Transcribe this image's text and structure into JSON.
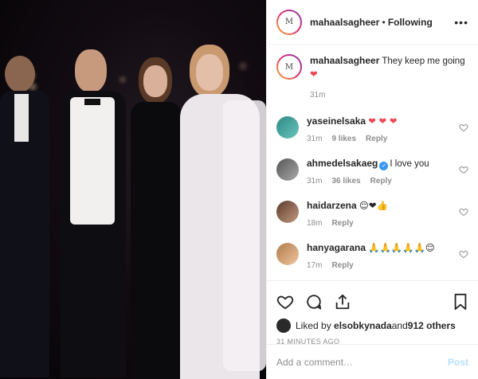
{
  "header": {
    "username": "mahaalsagheer",
    "separator": " • ",
    "follow_status": "Following",
    "more": "•••"
  },
  "caption": {
    "username": "mahaalsagheer",
    "text": "They keep me going",
    "emoji": "❤",
    "time": "31m"
  },
  "comments": [
    {
      "username": "yaseinelsaka",
      "text": "",
      "emoji": "❤ ❤ ❤",
      "time": "31m",
      "likes": "9 likes",
      "reply": "Reply",
      "verified": false
    },
    {
      "username": "ahmedelsakaeg",
      "text": "I love you",
      "emoji": "",
      "time": "31m",
      "likes": "36 likes",
      "reply": "Reply",
      "verified": true
    },
    {
      "username": "haidarzena",
      "text": "",
      "emoji": "😌❤👍",
      "time": "18m",
      "likes": "",
      "reply": "Reply",
      "verified": false
    },
    {
      "username": "hanyagarana",
      "text": "",
      "emoji": "🙏🙏🙏🙏🙏😌",
      "time": "17m",
      "likes": "",
      "reply": "Reply",
      "verified": false
    }
  ],
  "likes": {
    "prefix": "Liked by ",
    "user": "elsobkynada",
    "middle": " and ",
    "count": "912 others"
  },
  "timestamp": "31 MINUTES AGO",
  "add_comment": {
    "placeholder": "Add a comment…",
    "post_label": "Post"
  },
  "icons": {
    "like": "heart-icon",
    "comment": "comment-icon",
    "share": "share-icon",
    "save": "bookmark-icon"
  },
  "colors": {
    "heart_red": "#ed4956",
    "link_blue": "#b2dffc",
    "verified_blue": "#3897f0",
    "muted": "#8e8e8e"
  }
}
